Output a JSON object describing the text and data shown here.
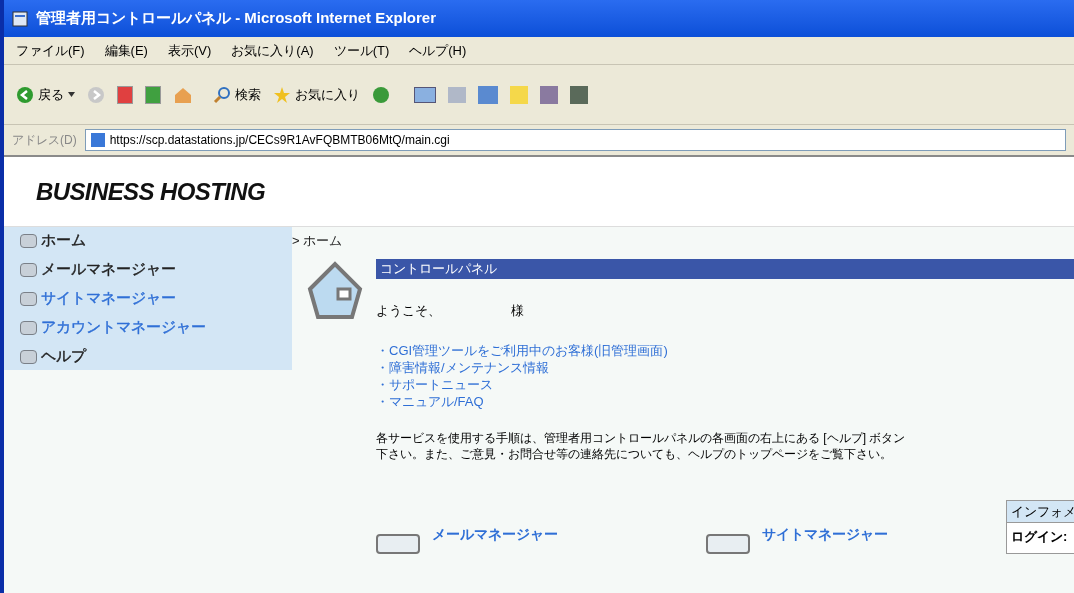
{
  "window": {
    "title": "管理者用コントロールパネル - Microsoft Internet Explorer"
  },
  "menu": [
    "ファイル(F)",
    "編集(E)",
    "表示(V)",
    "お気に入り(A)",
    "ツール(T)",
    "ヘルプ(H)"
  ],
  "toolbar": {
    "back": "戻る",
    "search": "検索",
    "favorites": "お気に入り"
  },
  "address": {
    "label": "アドレス(D)",
    "value": "https://scp.datastations.jp/CECs9R1AvFQBMTB06MtQ/main.cgi"
  },
  "logo": "BUSINESS HOSTING",
  "sidebar": {
    "items": [
      {
        "label": "ホーム",
        "color": "#222222"
      },
      {
        "label": "メールマネージャー",
        "color": "#222222"
      },
      {
        "label": "サイトマネージャー",
        "color": "#2f6fd6"
      },
      {
        "label": "アカウントマネージャー",
        "color": "#2f6fd6"
      },
      {
        "label": "ヘルプ",
        "color": "#222222"
      }
    ]
  },
  "breadcrumb": "> ホーム",
  "panel_title": "コントロールパネル",
  "welcome": {
    "prefix": "ようこそ、",
    "suffix": "様"
  },
  "links": [
    "・CGI管理ツールをご利用中のお客様(旧管理画面)",
    "・障害情報/メンテナンス情報",
    "・サポートニュース",
    "・マニュアル/FAQ"
  ],
  "instructions": [
    "各サービスを使用する手順は、管理者用コントロールパネルの各画面の右上にある [ヘルプ] ボタン",
    "下さい。また、ご意見・お問合せ等の連絡先についても、ヘルプのトップページをご覧下さい。"
  ],
  "services": [
    "メールマネージャー",
    "サイトマネージャー"
  ],
  "info": {
    "title": "インフォメ",
    "login": "ログイン:"
  }
}
